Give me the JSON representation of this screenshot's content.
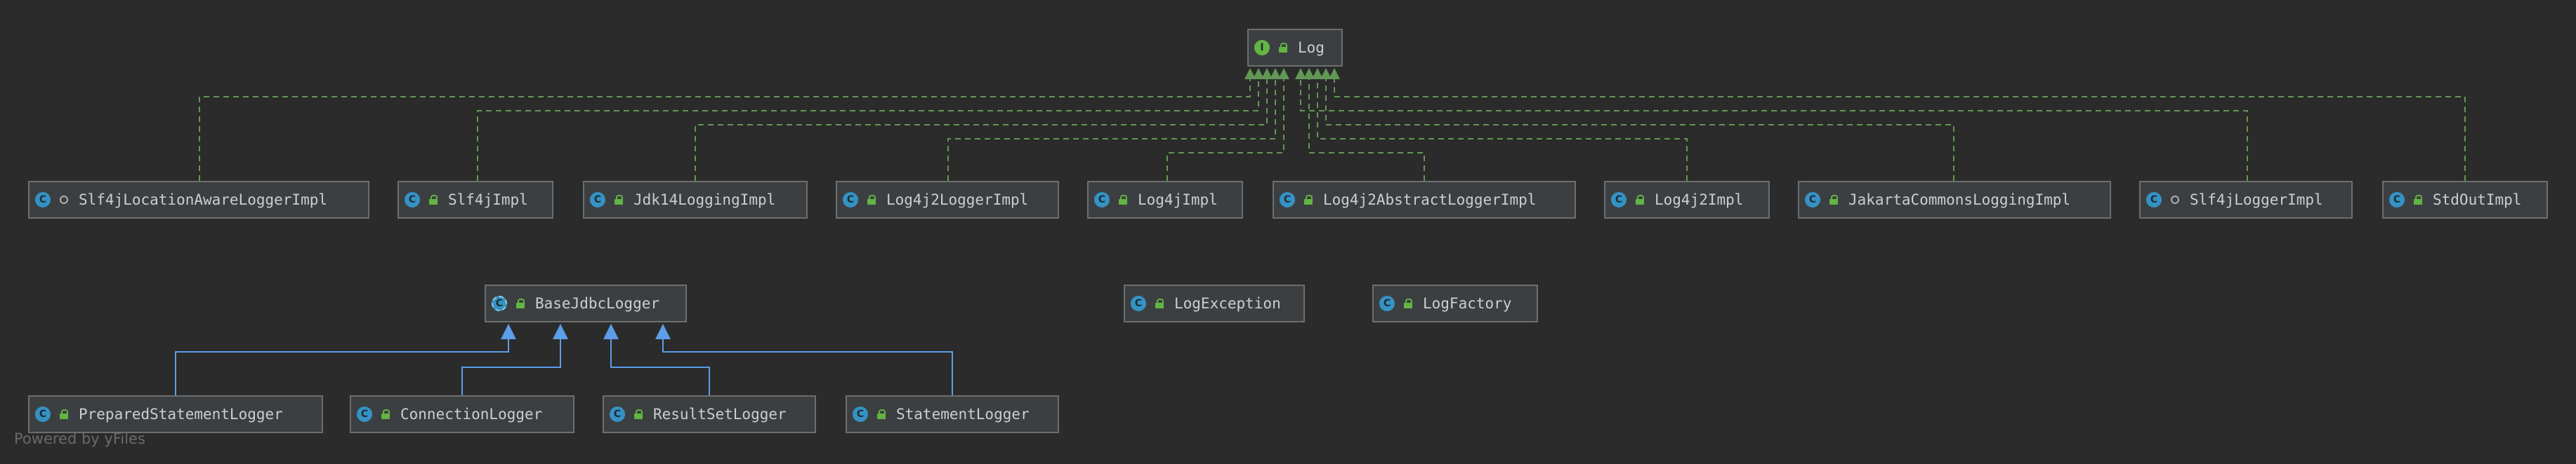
{
  "nodes": [
    {
      "id": "log",
      "label": "Log",
      "kind": "interface",
      "kind_letter": "I",
      "visibility": "public"
    },
    {
      "id": "slf4jlocation",
      "label": "Slf4jLocationAwareLoggerImpl",
      "kind": "class",
      "kind_letter": "C",
      "visibility": "package"
    },
    {
      "id": "slf4jimpl",
      "label": "Slf4jImpl",
      "kind": "class",
      "kind_letter": "C",
      "visibility": "public"
    },
    {
      "id": "jdk14",
      "label": "Jdk14LoggingImpl",
      "kind": "class",
      "kind_letter": "C",
      "visibility": "public"
    },
    {
      "id": "log4j2logger",
      "label": "Log4j2LoggerImpl",
      "kind": "class",
      "kind_letter": "C",
      "visibility": "public"
    },
    {
      "id": "log4jimpl",
      "label": "Log4jImpl",
      "kind": "class",
      "kind_letter": "C",
      "visibility": "public"
    },
    {
      "id": "log4j2abstract",
      "label": "Log4j2AbstractLoggerImpl",
      "kind": "class",
      "kind_letter": "C",
      "visibility": "public"
    },
    {
      "id": "log4j2impl",
      "label": "Log4j2Impl",
      "kind": "class",
      "kind_letter": "C",
      "visibility": "public"
    },
    {
      "id": "jakarta",
      "label": "JakartaCommonsLoggingImpl",
      "kind": "class",
      "kind_letter": "C",
      "visibility": "public"
    },
    {
      "id": "slf4jlogger",
      "label": "Slf4jLoggerImpl",
      "kind": "class",
      "kind_letter": "C",
      "visibility": "package"
    },
    {
      "id": "stdout",
      "label": "StdOutImpl",
      "kind": "class",
      "kind_letter": "C",
      "visibility": "public"
    },
    {
      "id": "basejdbc",
      "label": "BaseJdbcLogger",
      "kind": "abstract",
      "kind_letter": "C",
      "visibility": "public"
    },
    {
      "id": "logexception",
      "label": "LogException",
      "kind": "class",
      "kind_letter": "C",
      "visibility": "public"
    },
    {
      "id": "logfactory",
      "label": "LogFactory",
      "kind": "final",
      "kind_letter": "C",
      "visibility": "public"
    },
    {
      "id": "prepared",
      "label": "PreparedStatementLogger",
      "kind": "final",
      "kind_letter": "C",
      "visibility": "public"
    },
    {
      "id": "connection",
      "label": "ConnectionLogger",
      "kind": "final",
      "kind_letter": "C",
      "visibility": "public"
    },
    {
      "id": "resultset",
      "label": "ResultSetLogger",
      "kind": "final",
      "kind_letter": "C",
      "visibility": "public"
    },
    {
      "id": "statement",
      "label": "StatementLogger",
      "kind": "final",
      "kind_letter": "C",
      "visibility": "public"
    }
  ],
  "edges": [
    {
      "from": "slf4jlocation",
      "to": "log",
      "type": "implements"
    },
    {
      "from": "slf4jimpl",
      "to": "log",
      "type": "implements"
    },
    {
      "from": "jdk14",
      "to": "log",
      "type": "implements"
    },
    {
      "from": "log4j2logger",
      "to": "log",
      "type": "implements"
    },
    {
      "from": "log4jimpl",
      "to": "log",
      "type": "implements"
    },
    {
      "from": "log4j2abstract",
      "to": "log",
      "type": "implements"
    },
    {
      "from": "log4j2impl",
      "to": "log",
      "type": "implements"
    },
    {
      "from": "jakarta",
      "to": "log",
      "type": "implements"
    },
    {
      "from": "slf4jlogger",
      "to": "log",
      "type": "implements"
    },
    {
      "from": "stdout",
      "to": "log",
      "type": "implements"
    },
    {
      "from": "prepared",
      "to": "basejdbc",
      "type": "extends"
    },
    {
      "from": "connection",
      "to": "basejdbc",
      "type": "extends"
    },
    {
      "from": "resultset",
      "to": "basejdbc",
      "type": "extends"
    },
    {
      "from": "statement",
      "to": "basejdbc",
      "type": "extends"
    }
  ],
  "colors": {
    "background": "#2b2b2b",
    "implements_edge": "#629755",
    "extends_edge": "#5c9ee8",
    "node_fill": "#3c3f41",
    "node_border": "#6e6e6e"
  },
  "footer": "Powered by yFiles"
}
